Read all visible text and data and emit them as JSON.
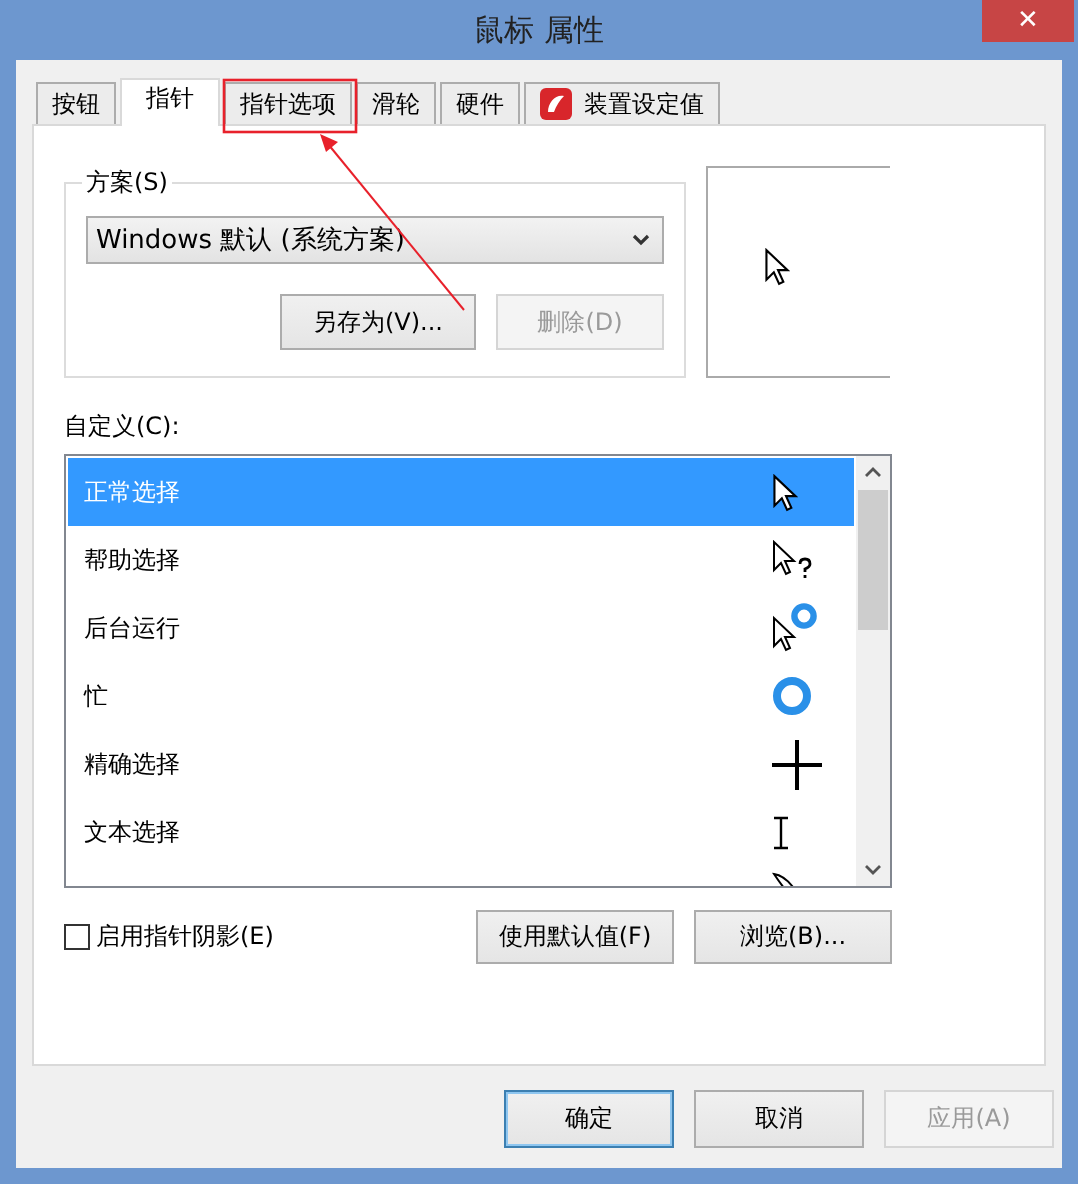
{
  "window": {
    "title": "鼠标 属性",
    "close": "✕"
  },
  "tabs": [
    {
      "label": "按钮",
      "selected": false,
      "kind": "plain"
    },
    {
      "label": "指针",
      "selected": true,
      "kind": "plain"
    },
    {
      "label": "指针选项",
      "selected": false,
      "kind": "plain"
    },
    {
      "label": "滑轮",
      "selected": false,
      "kind": "plain"
    },
    {
      "label": "硬件",
      "selected": false,
      "kind": "plain"
    },
    {
      "label": "装置设定值",
      "selected": false,
      "kind": "icon"
    }
  ],
  "scheme": {
    "label": "方案(S)",
    "value": "Windows 默认 (系统方案)",
    "buttons": [
      {
        "label": "另存为(V)...",
        "disabled": false
      },
      {
        "label": "删除(D)",
        "disabled": true
      }
    ]
  },
  "custom": {
    "label": "自定义(C):",
    "rows": [
      {
        "label": "正常选择",
        "selected": true,
        "kind": "arrow"
      },
      {
        "label": "帮助选择",
        "selected": false,
        "kind": "help"
      },
      {
        "label": "后台运行",
        "selected": false,
        "kind": "working"
      },
      {
        "label": "忙",
        "selected": false,
        "kind": "busy"
      },
      {
        "label": "精确选择",
        "selected": false,
        "kind": "cross"
      },
      {
        "label": "文本选择",
        "selected": false,
        "kind": "text"
      },
      {
        "selected": false,
        "kind": "pen"
      }
    ]
  },
  "shadow": {
    "label": "启用指针阴影(E)",
    "checked": false
  },
  "list_buttons": [
    {
      "label": "使用默认值(F)"
    },
    {
      "label": "浏览(B)..."
    }
  ],
  "dialog_buttons": [
    {
      "label": "确定",
      "focused": true,
      "disabled": false
    },
    {
      "label": "取消",
      "focused": false,
      "disabled": false
    },
    {
      "label": "应用(A)",
      "focused": false,
      "disabled": true
    }
  ]
}
